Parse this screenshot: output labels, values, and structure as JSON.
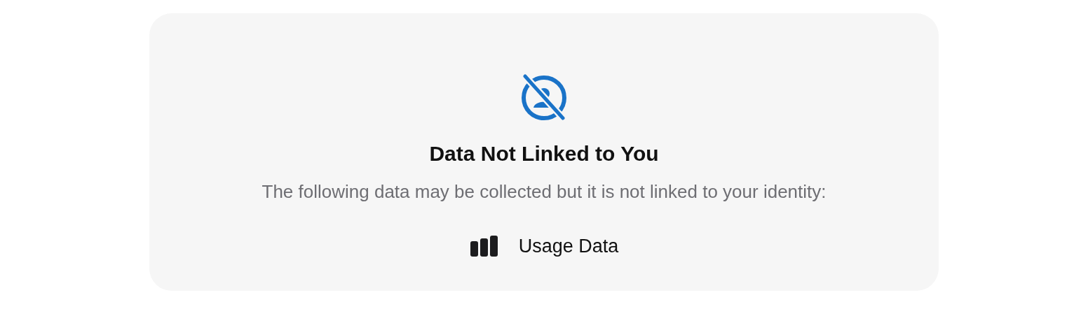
{
  "card": {
    "title": "Data Not Linked to You",
    "description": "The following data may be collected but it is not linked to your identity:",
    "items": [
      {
        "kind": "usage",
        "label": "Usage Data"
      }
    ]
  }
}
